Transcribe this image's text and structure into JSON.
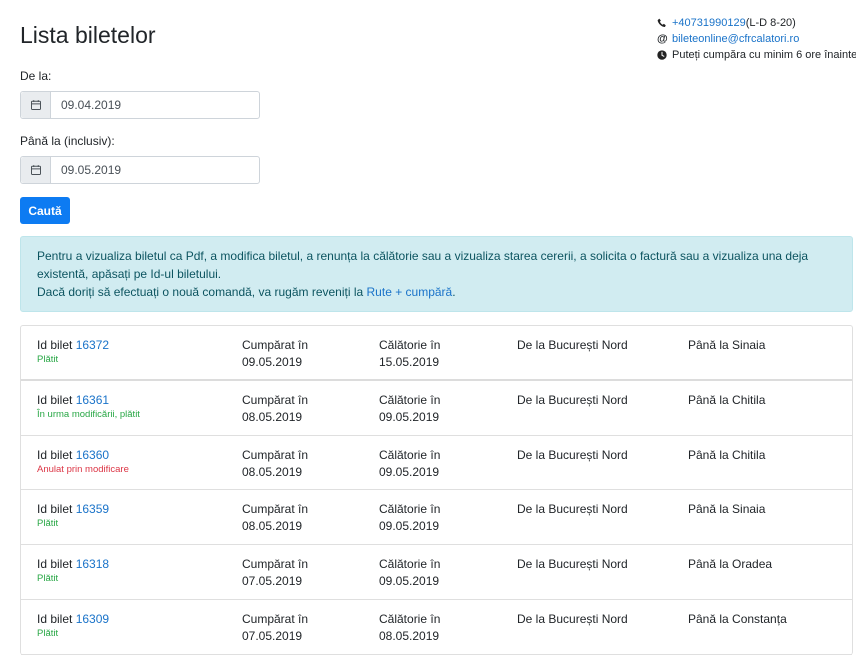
{
  "page": {
    "title": "Lista biletelor"
  },
  "contact": {
    "phone": "+40731990129",
    "phone_hours": " (L-D 8-20)",
    "email": "bileteonline@cfrcalatori.ro",
    "purchase_note": "Puteți cumpăra cu minim 6 ore înainte"
  },
  "filters": {
    "from_label": "De la:",
    "from_value": "09.04.2019",
    "to_label": "Până la (inclusiv):",
    "to_value": "09.05.2019",
    "search_label": "Caută"
  },
  "info": {
    "line1": "Pentru a vizualiza biletul ca Pdf, a modifica biletul, a renunța la călătorie sau a vizualiza starea cererii, a solicita o factură sau a vizualiza una deja existentă, apăsați pe Id-ul biletului.",
    "line2_prefix": "Dacă doriți să efectuați o nouă comandă, va rugăm reveniți la ",
    "line2_link": "Rute + cumpără",
    "line2_suffix": "."
  },
  "colors": {
    "primary": "#0d7bf2",
    "success": "#28a745",
    "danger": "#dc3545",
    "info_bg": "#d1ecf1"
  },
  "tickets": [
    {
      "id_label": "Id bilet ",
      "id": "16372",
      "status": "Plătit",
      "status_type": "ok",
      "bought_label": "Cumpărat în",
      "bought": "09.05.2019",
      "travel_label": "Călătorie în",
      "travel": "15.05.2019",
      "from": "De la București Nord",
      "to": "Până la Sinaia"
    },
    {
      "id_label": "Id bilet ",
      "id": "16361",
      "status": "În urma modificării, plătit",
      "status_type": "ok",
      "bought_label": "Cumpărat în",
      "bought": "08.05.2019",
      "travel_label": "Călătorie în",
      "travel": "09.05.2019",
      "from": "De la București Nord",
      "to": "Până la Chitila"
    },
    {
      "id_label": "Id bilet ",
      "id": "16360",
      "status": "Anulat prin modificare",
      "status_type": "cancel",
      "bought_label": "Cumpărat în",
      "bought": "08.05.2019",
      "travel_label": "Călătorie în",
      "travel": "09.05.2019",
      "from": "De la București Nord",
      "to": "Până la Chitila"
    },
    {
      "id_label": "Id bilet ",
      "id": "16359",
      "status": "Plătit",
      "status_type": "ok",
      "bought_label": "Cumpărat în",
      "bought": "08.05.2019",
      "travel_label": "Călătorie în",
      "travel": "09.05.2019",
      "from": "De la București Nord",
      "to": "Până la Sinaia"
    },
    {
      "id_label": "Id bilet ",
      "id": "16318",
      "status": "Plătit",
      "status_type": "ok",
      "bought_label": "Cumpărat în",
      "bought": "07.05.2019",
      "travel_label": "Călătorie în",
      "travel": "09.05.2019",
      "from": "De la București Nord",
      "to": "Până la Oradea"
    },
    {
      "id_label": "Id bilet ",
      "id": "16309",
      "status": "Plătit",
      "status_type": "ok",
      "bought_label": "Cumpărat în",
      "bought": "07.05.2019",
      "travel_label": "Călătorie în",
      "travel": "08.05.2019",
      "from": "De la București Nord",
      "to": "Până la Constanța"
    }
  ]
}
